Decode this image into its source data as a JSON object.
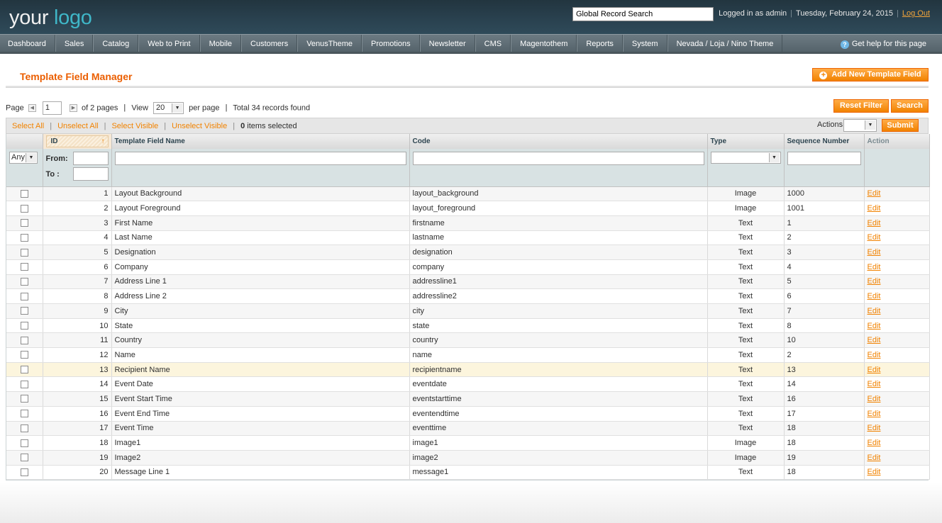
{
  "header": {
    "logo_your": "your ",
    "logo_logo": "logo",
    "search_value": "Global Record Search",
    "logged_in": "Logged in as admin",
    "date": "Tuesday, February 24, 2015",
    "logout": "Log Out"
  },
  "nav": {
    "items": [
      "Dashboard",
      "Sales",
      "Catalog",
      "Web to Print",
      "Mobile",
      "Customers",
      "VenusTheme",
      "Promotions",
      "Newsletter",
      "CMS",
      "Magentothem",
      "Reports",
      "System",
      "Nevada / Loja / Nino Theme"
    ],
    "help": "Get help for this page"
  },
  "page": {
    "title": "Template Field Manager",
    "add_button": "Add New Template Field",
    "reset_filter": "Reset Filter",
    "search": "Search"
  },
  "pager": {
    "page_label": "Page",
    "page_value": "1",
    "of_pages": "of 2 pages",
    "view_label": "View",
    "per_page_value": "20",
    "per_page_label": "per page",
    "total": "Total 34 records found"
  },
  "massaction": {
    "select_all": "Select All",
    "unselect_all": "Unselect All",
    "select_visible": "Select Visible",
    "unselect_visible": "Unselect Visible",
    "selected_count": "0",
    "selected_label": " items selected",
    "actions_label": "Actions",
    "submit": "Submit"
  },
  "grid": {
    "columns": [
      "ID",
      "Template Field Name",
      "Code",
      "Type",
      "Sequence Number",
      "Action"
    ],
    "filter": {
      "any": "Any",
      "from": "From:",
      "to": "To :"
    },
    "rows": [
      {
        "id": "1",
        "name": "Layout Background",
        "code": "layout_background",
        "type": "Image",
        "seq": "1000",
        "action": "Edit"
      },
      {
        "id": "2",
        "name": "Layout Foreground",
        "code": "layout_foreground",
        "type": "Image",
        "seq": "1001",
        "action": "Edit"
      },
      {
        "id": "3",
        "name": "First Name",
        "code": "firstname",
        "type": "Text",
        "seq": "1",
        "action": "Edit"
      },
      {
        "id": "4",
        "name": "Last Name",
        "code": "lastname",
        "type": "Text",
        "seq": "2",
        "action": "Edit"
      },
      {
        "id": "5",
        "name": "Designation",
        "code": "designation",
        "type": "Text",
        "seq": "3",
        "action": "Edit"
      },
      {
        "id": "6",
        "name": "Company",
        "code": "company",
        "type": "Text",
        "seq": "4",
        "action": "Edit"
      },
      {
        "id": "7",
        "name": "Address Line 1",
        "code": "addressline1",
        "type": "Text",
        "seq": "5",
        "action": "Edit"
      },
      {
        "id": "8",
        "name": "Address Line 2",
        "code": "addressline2",
        "type": "Text",
        "seq": "6",
        "action": "Edit"
      },
      {
        "id": "9",
        "name": "City",
        "code": "city",
        "type": "Text",
        "seq": "7",
        "action": "Edit"
      },
      {
        "id": "10",
        "name": "State",
        "code": "state",
        "type": "Text",
        "seq": "8",
        "action": "Edit"
      },
      {
        "id": "11",
        "name": "Country",
        "code": "country",
        "type": "Text",
        "seq": "10",
        "action": "Edit"
      },
      {
        "id": "12",
        "name": "Name",
        "code": "name",
        "type": "Text",
        "seq": "2",
        "action": "Edit"
      },
      {
        "id": "13",
        "name": "Recipient Name",
        "code": "recipientname",
        "type": "Text",
        "seq": "13",
        "action": "Edit"
      },
      {
        "id": "14",
        "name": "Event Date",
        "code": "eventdate",
        "type": "Text",
        "seq": "14",
        "action": "Edit"
      },
      {
        "id": "15",
        "name": "Event Start Time",
        "code": "eventstarttime",
        "type": "Text",
        "seq": "16",
        "action": "Edit"
      },
      {
        "id": "16",
        "name": "Event End Time",
        "code": "eventendtime",
        "type": "Text",
        "seq": "17",
        "action": "Edit"
      },
      {
        "id": "17",
        "name": "Event Time",
        "code": "eventtime",
        "type": "Text",
        "seq": "18",
        "action": "Edit"
      },
      {
        "id": "18",
        "name": "Image1",
        "code": "image1",
        "type": "Image",
        "seq": "18",
        "action": "Edit"
      },
      {
        "id": "19",
        "name": "Image2",
        "code": "image2",
        "type": "Image",
        "seq": "19",
        "action": "Edit"
      },
      {
        "id": "20",
        "name": "Message Line 1",
        "code": "message1",
        "type": "Text",
        "seq": "18",
        "action": "Edit"
      }
    ]
  },
  "colors": {
    "accent": "#f18200",
    "title": "#eb5e00",
    "header": "#2a4250",
    "logo": "#3fb7c8"
  }
}
